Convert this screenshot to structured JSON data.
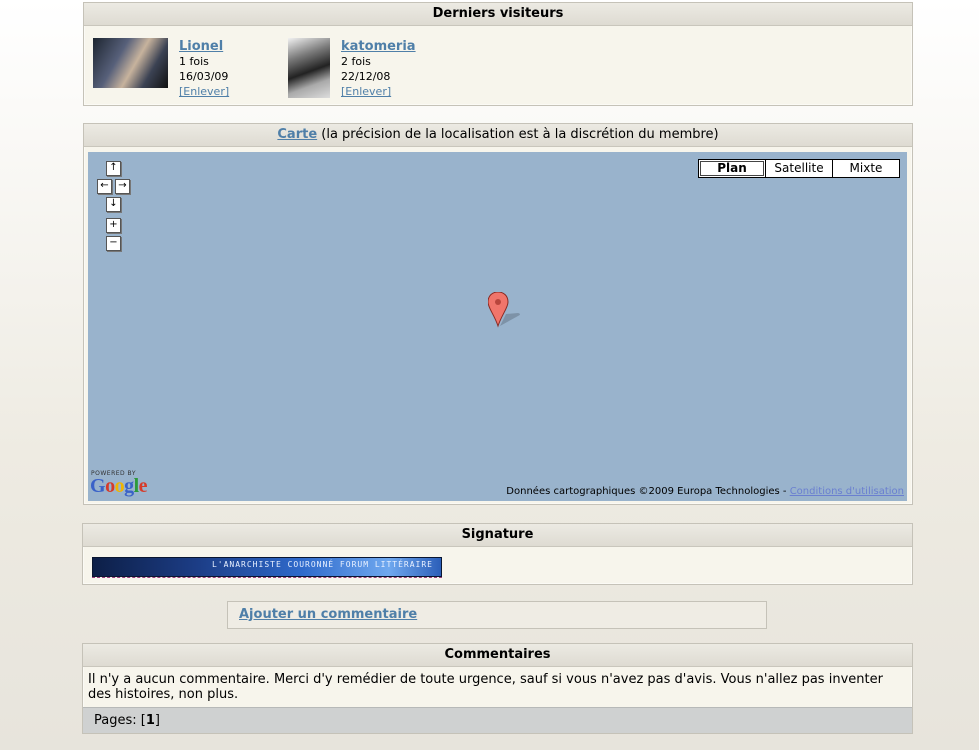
{
  "visitors": {
    "title": "Derniers visiteurs",
    "items": [
      {
        "name": "Lionel",
        "visits": "1 fois",
        "date": "16/03/09",
        "remove": "[Enlever]"
      },
      {
        "name": "katomeria",
        "visits": "2 fois",
        "date": "22/12/08",
        "remove": "[Enlever]"
      }
    ]
  },
  "map": {
    "link": "Carte",
    "caption": " (la précision de la localisation est à la discrétion du membre)",
    "types": [
      "Plan",
      "Satellite",
      "Mixte"
    ],
    "selected_type": "Plan",
    "powered_by": "POWERED BY",
    "logo": "Google",
    "copyright": "Données cartographiques ©2009 Europa Technologies - ",
    "terms": "Conditions d'utilisation",
    "background_color": "#99b3cc"
  },
  "signature": {
    "title": "Signature",
    "banner_text": "L'Anarchiste Couronné Forum Littéraire"
  },
  "add_comment": {
    "label": "Ajouter un commentaire"
  },
  "comments": {
    "title": "Commentaires",
    "body": "Il n'y a aucun commentaire. Merci d'y remédier de toute urgence, sauf si vous n'avez pas d'avis. Vous n'allez pas inventer des histoires, non plus.",
    "pages_label": "Pages: ",
    "current_page": "1"
  },
  "colors": {
    "link": "#4f7fa8",
    "panel_bg": "#f7f5ec",
    "pages_bar": "#cfd1d1"
  }
}
